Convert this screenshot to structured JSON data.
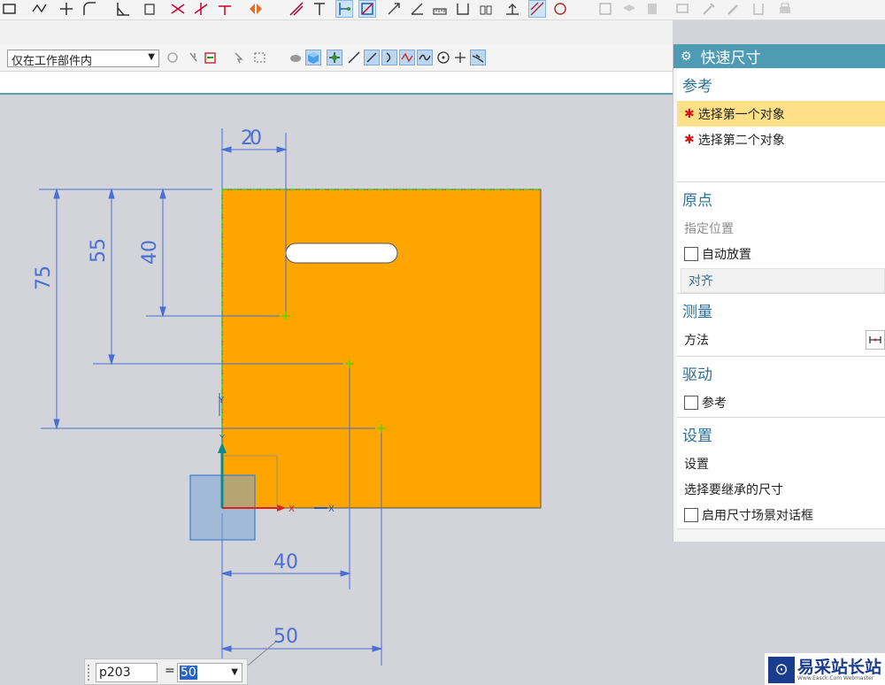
{
  "toolbar": {
    "scope_select_value": "仅在工作部件内"
  },
  "panel": {
    "title": "快速尺寸",
    "sections": {
      "reference": {
        "title": "参考",
        "first_object": "选择第一个对象",
        "second_object": "选择第二个对象"
      },
      "origin": {
        "title": "原点",
        "specify_location": "指定位置",
        "auto_place": "自动放置",
        "align": "对齐"
      },
      "measure": {
        "title": "测量",
        "method": "方法"
      },
      "drive": {
        "title": "驱动",
        "reference": "参考"
      },
      "settings": {
        "title": "设置",
        "settings": "设置",
        "inherit": "选择要继承的尺寸",
        "enable_dialog": "启用尺寸场景对话框"
      }
    }
  },
  "sketch": {
    "dimensions": {
      "top_width": "20",
      "vertical_75": "75",
      "vertical_55": "55",
      "vertical_40": "40",
      "bottom_40": "40",
      "bottom_50": "50"
    },
    "axis_x": "X",
    "axis_y": "Y",
    "colors": {
      "plate": "#ffa500",
      "dimension": "#4a6fd6",
      "point": "#5fd000"
    }
  },
  "dim_popup": {
    "name": "p203",
    "equals": "=",
    "value": "50"
  },
  "watermark": {
    "text": "易采站长站",
    "sub": "Www.Easck.Com Webmaster"
  }
}
